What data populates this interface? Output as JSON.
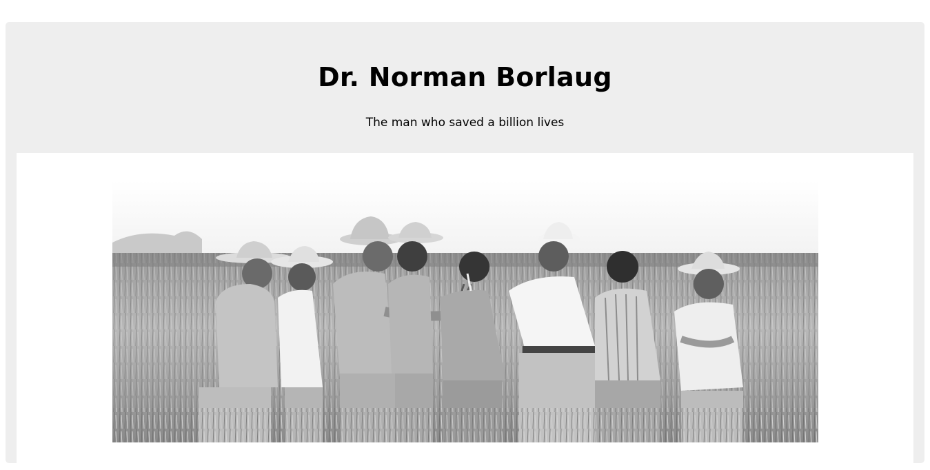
{
  "tribute": {
    "title": "Dr. Norman Borlaug",
    "tagline": "The man who saved a billion lives"
  },
  "image": {
    "description_icon": "photo-icon",
    "scene": "black-and-white photo of men in a wheat field"
  }
}
